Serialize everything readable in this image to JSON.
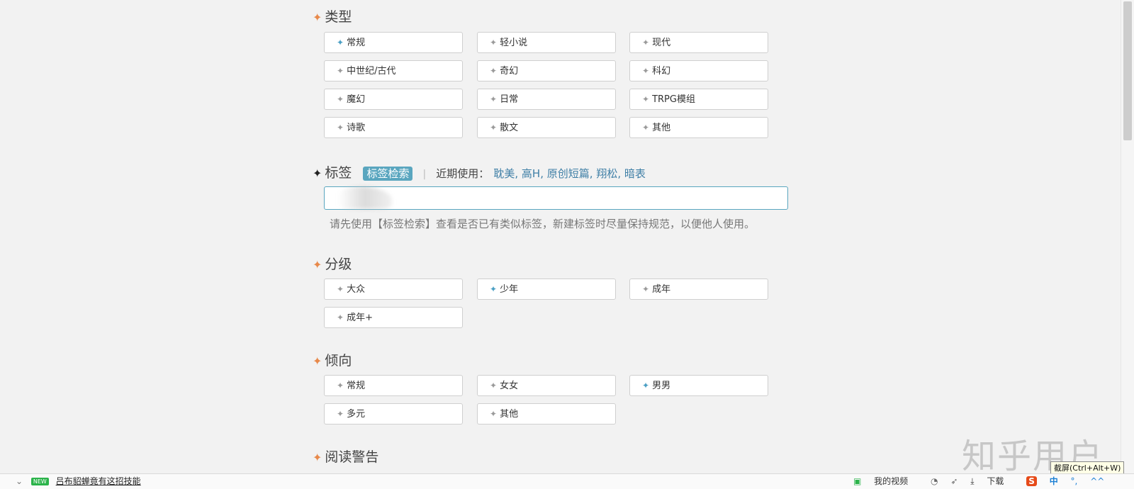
{
  "sections": {
    "type": {
      "title": "类型",
      "options": [
        {
          "label": "常规",
          "selected": true
        },
        {
          "label": "轻小说",
          "selected": false
        },
        {
          "label": "现代",
          "selected": false
        },
        {
          "label": "中世纪/古代",
          "selected": false
        },
        {
          "label": "奇幻",
          "selected": false
        },
        {
          "label": "科幻",
          "selected": false
        },
        {
          "label": "魔幻",
          "selected": false
        },
        {
          "label": "日常",
          "selected": false
        },
        {
          "label": "TRPG模组",
          "selected": false
        },
        {
          "label": "诗歌",
          "selected": false
        },
        {
          "label": "散文",
          "selected": false
        },
        {
          "label": "其他",
          "selected": false
        }
      ]
    },
    "tags": {
      "title": "标签",
      "search_button": "标签检索",
      "recent_label": "近期使用：",
      "recent": [
        "耽美",
        "高H",
        "原创短篇",
        "翔松",
        "暗表"
      ],
      "hint": "请先使用【标签检索】查看是否已有类似标签，新建标签时尽量保持规范，以便他人使用。"
    },
    "rating": {
      "title": "分级",
      "options": [
        {
          "label": "大众",
          "selected": false
        },
        {
          "label": "少年",
          "selected": true
        },
        {
          "label": "成年",
          "selected": false
        },
        {
          "label": "成年+",
          "selected": false
        }
      ]
    },
    "orientation": {
      "title": "倾向",
      "options": [
        {
          "label": "常规",
          "selected": false
        },
        {
          "label": "女女",
          "selected": false
        },
        {
          "label": "男男",
          "selected": true
        },
        {
          "label": "多元",
          "selected": false
        },
        {
          "label": "其他",
          "selected": false
        }
      ]
    },
    "warning": {
      "title": "阅读警告"
    }
  },
  "statusbar": {
    "news_badge": "NEW",
    "news_text": "吕布貂蝉竟有这招技能",
    "my_videos": "我的视频",
    "download": "下载",
    "ime_lang": "中",
    "sogou": "S"
  },
  "tooltip": "截屏(Ctrl+Alt+W)",
  "watermark": "知乎用户",
  "colors": {
    "accent_star": "#e8894a",
    "selected_icon": "#4a9fc4",
    "link": "#3f7fa6",
    "button_bg": "#5aa6bf"
  }
}
